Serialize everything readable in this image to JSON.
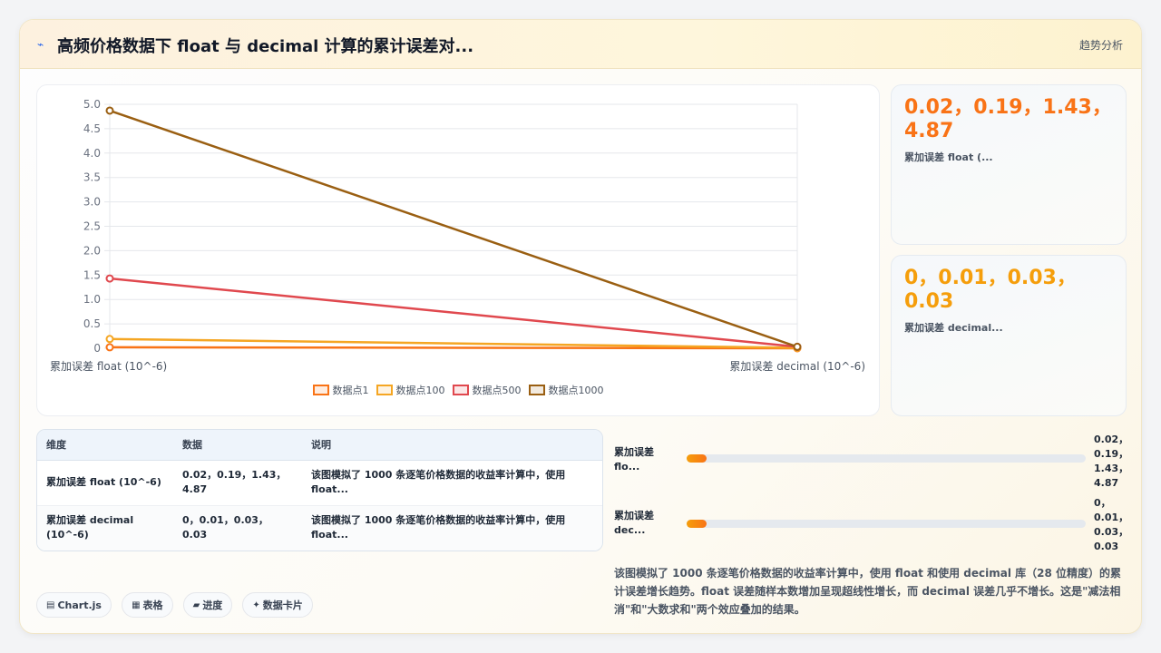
{
  "header": {
    "icon": "trend-icon",
    "title": "高频价格数据下 float 与 decimal 计算的累计误差对...",
    "right_label": "趋势分析"
  },
  "chart_data": {
    "type": "line",
    "categories": [
      "累加误差 float (10^-6)",
      "累加误差 decimal (10^-6)"
    ],
    "series": [
      {
        "name": "数据点1",
        "color": "#f97316",
        "values": [
          0.02,
          0
        ]
      },
      {
        "name": "数据点100",
        "color": "#f5a623",
        "values": [
          0.19,
          0.01
        ]
      },
      {
        "name": "数据点500",
        "color": "#e0484e",
        "values": [
          1.43,
          0.03
        ]
      },
      {
        "name": "数据点1000",
        "color": "#9a5f12",
        "values": [
          4.87,
          0.03
        ]
      }
    ],
    "ylim": [
      0,
      5.0
    ],
    "yticks": [
      "0",
      "0.5",
      "1.0",
      "1.5",
      "2.0",
      "2.5",
      "3.0",
      "3.5",
      "4.0",
      "4.5",
      "5.0"
    ],
    "grid": true,
    "legend": "bottom"
  },
  "stats": [
    {
      "value": "0.02，0.19，1.43，4.87",
      "label": "累加误差 float (...",
      "color": "#f97316"
    },
    {
      "value": "0，0.01，0.03，0.03",
      "label": "累加误差 decimal...",
      "color": "#f59e0b"
    }
  ],
  "table": {
    "headers": [
      "维度",
      "数据",
      "说明"
    ],
    "rows": [
      {
        "dim": "累加误差 float (10^-6)",
        "data": "0.02，0.19，1.43，4.87",
        "desc": "该图模拟了 1000 条逐笔价格数据的收益率计算中，使用 float..."
      },
      {
        "dim": "累加误差 decimal (10^-6)",
        "data": "0，0.01，0.03，0.03",
        "desc": "该图模拟了 1000 条逐笔价格数据的收益率计算中，使用 float..."
      }
    ]
  },
  "progress": [
    {
      "label": "累加误差 flo...",
      "value": "0.02，0.19，1.43，4.87",
      "fraction": 0.05
    },
    {
      "label": "累加误差 dec...",
      "value": "0，0.01，0.03，0.03",
      "fraction": 0.05
    }
  ],
  "summary": "该图模拟了 1000 条逐笔价格数据的收益率计算中，使用 float 和使用 decimal 库（28 位精度）的累计误差增长趋势。float 误差随样本数增加呈现超线性增长，而 decimal 误差几乎不增长。这是\"减法相消\"和\"大数求和\"两个效应叠加的结果。",
  "tags": [
    {
      "icon": "chart-icon",
      "glyph": "▤",
      "label": "Chart.js"
    },
    {
      "icon": "table-icon",
      "glyph": "▦",
      "label": "表格"
    },
    {
      "icon": "progress-icon",
      "glyph": "▰",
      "label": "进度"
    },
    {
      "icon": "sparkle-icon",
      "glyph": "✦",
      "label": "数据卡片"
    }
  ]
}
